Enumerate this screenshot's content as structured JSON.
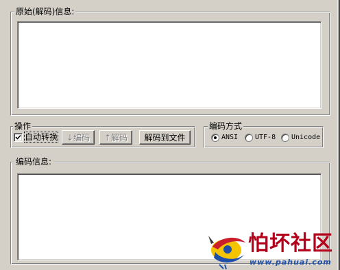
{
  "original_group": {
    "legend": "原始(解码)信息:"
  },
  "operation_group": {
    "legend": "操作",
    "auto_convert": {
      "label": "自动转换",
      "checked": true
    },
    "encode_button": "↓编码",
    "decode_button": "↑解码",
    "decode_to_file_button": "解码到文件"
  },
  "encoding_group": {
    "legend": "编码方式",
    "options": [
      {
        "label": "ANSI",
        "selected": true
      },
      {
        "label": "UTF-8",
        "selected": false
      },
      {
        "label": "Unicode",
        "selected": false
      }
    ]
  },
  "encoded_group": {
    "legend": "编码信息:"
  },
  "watermark": {
    "title": "怕坏社区",
    "url": "www.pahuai.com"
  },
  "colors": {
    "face": "#d4d0c8",
    "shadow": "#808080",
    "highlight": "#ffffff",
    "watermark_title": "#b3001b",
    "watermark_url": "#1f4fa8"
  }
}
